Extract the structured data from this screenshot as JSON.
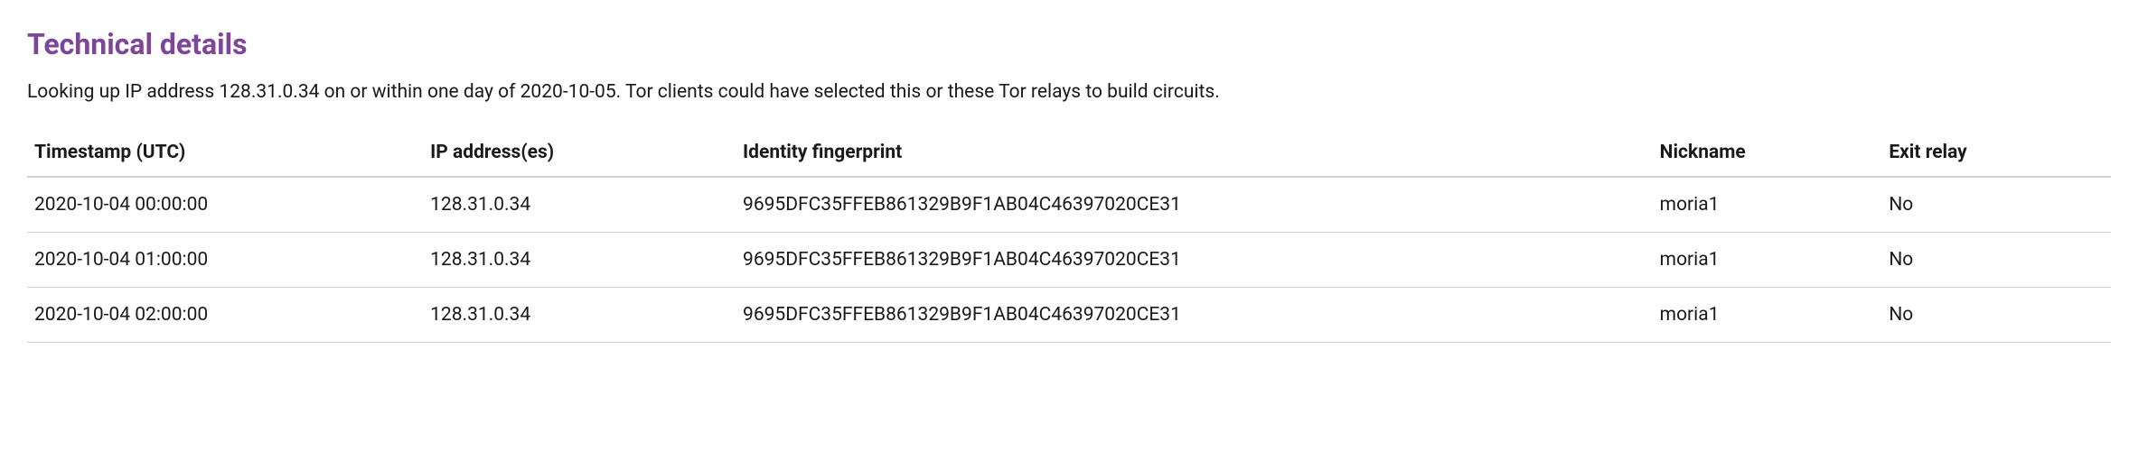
{
  "heading": "Technical details",
  "description": "Looking up IP address 128.31.0.34 on or within one day of 2020-10-05. Tor clients could have selected this or these Tor relays to build circuits.",
  "table": {
    "headers": {
      "timestamp": "Timestamp (UTC)",
      "ip": "IP address(es)",
      "fingerprint": "Identity fingerprint",
      "nickname": "Nickname",
      "exit": "Exit relay"
    },
    "rows": [
      {
        "timestamp": "2020-10-04 00:00:00",
        "ip": "128.31.0.34",
        "fingerprint": "9695DFC35FFEB861329B9F1AB04C46397020CE31",
        "nickname": "moria1",
        "exit": "No"
      },
      {
        "timestamp": "2020-10-04 01:00:00",
        "ip": "128.31.0.34",
        "fingerprint": "9695DFC35FFEB861329B9F1AB04C46397020CE31",
        "nickname": "moria1",
        "exit": "No"
      },
      {
        "timestamp": "2020-10-04 02:00:00",
        "ip": "128.31.0.34",
        "fingerprint": "9695DFC35FFEB861329B9F1AB04C46397020CE31",
        "nickname": "moria1",
        "exit": "No"
      }
    ]
  }
}
